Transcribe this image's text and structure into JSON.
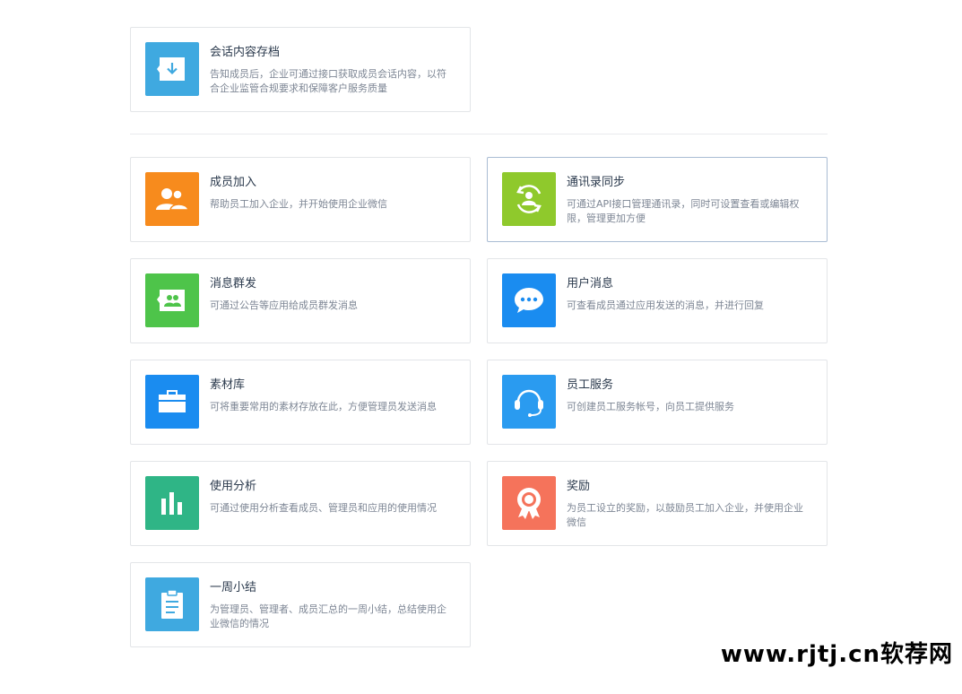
{
  "archive": {
    "title": "会话内容存档",
    "desc": "告知成员后，企业可通过接口获取成员会话内容，以符合企业监管合规要求和保障客户服务质量",
    "color": "#3fa9e0",
    "icon": "download-tray-icon"
  },
  "features": [
    {
      "title": "成员加入",
      "desc": "帮助员工加入企业，并开始使用企业微信",
      "color": "#f78b1d",
      "icon": "members-icon"
    },
    {
      "title": "通讯录同步",
      "desc": "可通过API接口管理通讯录，同时可设置查看或编辑权限，管理更加方便",
      "color": "#8fc92c",
      "icon": "contact-sync-icon"
    },
    {
      "title": "消息群发",
      "desc": "可通过公告等应用给成员群发消息",
      "color": "#4ec44a",
      "icon": "broadcast-icon"
    },
    {
      "title": "用户消息",
      "desc": "可查看成员通过应用发送的消息，并进行回复",
      "color": "#1a8cf0",
      "icon": "chat-bubble-icon"
    },
    {
      "title": "素材库",
      "desc": "可将重要常用的素材存放在此，方便管理员发送消息",
      "color": "#1a8cf0",
      "icon": "briefcase-icon"
    },
    {
      "title": "员工服务",
      "desc": "可创建员工服务帐号，向员工提供服务",
      "color": "#2a9bf0",
      "icon": "headset-icon"
    },
    {
      "title": "使用分析",
      "desc": "可通过使用分析查看成员、管理员和应用的使用情况",
      "color": "#2fb586",
      "icon": "bar-chart-icon"
    },
    {
      "title": "奖励",
      "desc": "为员工设立的奖励，以鼓励员工加入企业，并使用企业微信",
      "color": "#f5735b",
      "icon": "award-icon"
    },
    {
      "title": "一周小结",
      "desc": "为管理员、管理者、成员汇总的一周小结，总结使用企业微信的情况",
      "color": "#3fa9e0",
      "icon": "clipboard-icon"
    }
  ],
  "site_watermark": "www.rjtj.cn软荐网"
}
